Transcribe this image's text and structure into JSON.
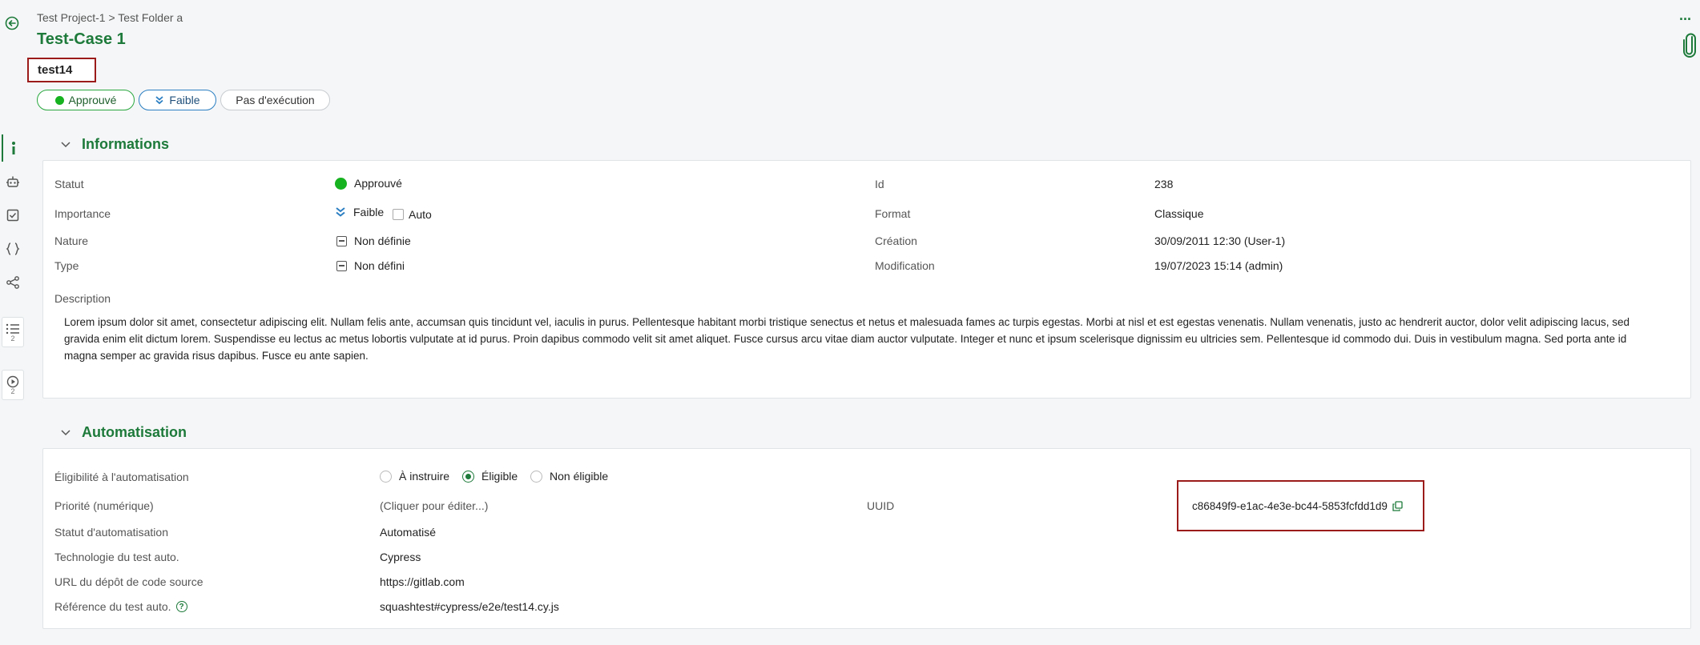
{
  "header": {
    "breadcrumb": "Test Project-1 > Test Folder a",
    "title": "Test-Case 1",
    "reference": "test14",
    "chips": {
      "status": "Approuvé",
      "importance": "Faible",
      "execution": "Pas d'exécution"
    }
  },
  "rail": {
    "items": [
      {
        "icon": "info-icon"
      },
      {
        "icon": "robot-icon"
      },
      {
        "icon": "checklist-icon"
      },
      {
        "icon": "braces-icon"
      },
      {
        "icon": "share-icon"
      },
      {
        "icon": "steps-list-icon",
        "count": "2"
      },
      {
        "icon": "execution-play-icon",
        "count": "2"
      }
    ]
  },
  "informations": {
    "title": "Informations",
    "statut_label": "Statut",
    "statut_value": "Approuvé",
    "importance_label": "Importance",
    "importance_value": "Faible",
    "auto_label": "Auto",
    "nature_label": "Nature",
    "nature_value": "Non définie",
    "type_label": "Type",
    "type_value": "Non défini",
    "id_label": "Id",
    "id_value": "238",
    "format_label": "Format",
    "format_value": "Classique",
    "creation_label": "Création",
    "creation_value": "30/09/2011 12:30 (User-1)",
    "modification_label": "Modification",
    "modification_value": "19/07/2023 15:14 (admin)",
    "description_label": "Description",
    "description_text": "Lorem ipsum dolor sit amet, consectetur adipiscing elit. Nullam felis ante, accumsan quis tincidunt vel, iaculis in purus. Pellentesque habitant morbi tristique senectus et netus et malesuada fames ac turpis egestas. Morbi at nisl et est egestas venenatis. Nullam venenatis, justo ac hendrerit auctor, dolor velit adipiscing lacus, sed gravida enim elit dictum lorem. Suspendisse eu lectus ac metus lobortis vulputate at id purus. Proin dapibus commodo velit sit amet aliquet. Fusce cursus arcu vitae diam auctor vulputate. Integer et nunc et ipsum scelerisque dignissim eu ultricies sem. Pellentesque id commodo dui. Duis in vestibulum magna. Sed porta ante id magna semper ac gravida risus dapibus. Fusce eu ante sapien."
  },
  "automatisation": {
    "title": "Automatisation",
    "eligibility_label": "Éligibilité à l'automatisation",
    "eligibility_options": [
      "À instruire",
      "Éligible",
      "Non éligible"
    ],
    "eligibility_selected": "Éligible",
    "priority_label": "Priorité (numérique)",
    "priority_placeholder": "(Cliquer pour éditer...)",
    "uuid_label": "UUID",
    "uuid_value": "c86849f9-e1ac-4e3e-bc44-5853fcfdd1d9",
    "auto_status_label": "Statut d'automatisation",
    "auto_status_value": "Automatisé",
    "technology_label": "Technologie du test auto.",
    "technology_value": "Cypress",
    "repo_label": "URL du dépôt de code source",
    "repo_value": "https://gitlab.com",
    "reference_label": "Référence du test auto.",
    "reference_value": "squashtest#cypress/e2e/test14.cy.js"
  },
  "colors": {
    "brand_green": "#1d7a3a",
    "status_green": "#17b21f",
    "importance_blue": "#2b7fc2",
    "highlight_red": "#9b1b1b"
  }
}
